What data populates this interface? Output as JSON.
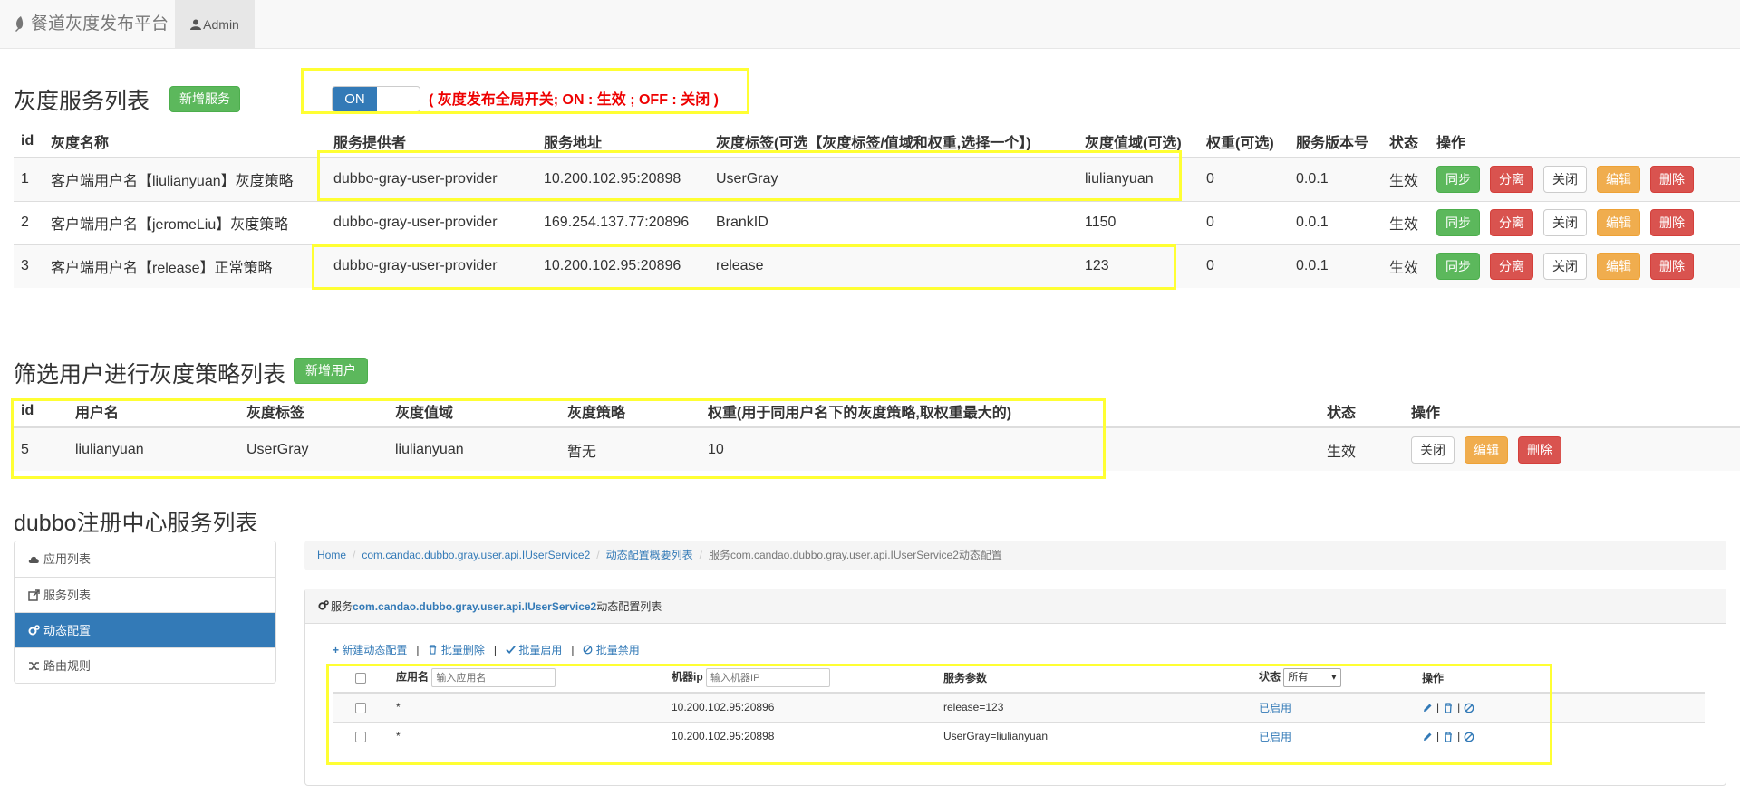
{
  "navbar": {
    "brand": "餐道灰度发布平台",
    "user": "Admin"
  },
  "gray_services": {
    "title": "灰度服务列表",
    "add_button": "新增服务",
    "toggle_on": "ON",
    "toggle_note": "( 灰度发布全局开关; ON : 生效 ; OFF : 关闭 )",
    "headers": [
      "id",
      "灰度名称",
      "服务提供者",
      "服务地址",
      "灰度标签(可选【灰度标签/值域和权重,选择一个】)",
      "灰度值域(可选)",
      "权重(可选)",
      "服务版本号",
      "状态",
      "操作"
    ],
    "rows": [
      {
        "id": "1",
        "name": "客户端用户名【liulianyuan】灰度策略",
        "provider": "dubbo-gray-user-provider",
        "address": "10.200.102.95:20898",
        "tag": "UserGray",
        "range": "liulianyuan",
        "weight": "0",
        "version": "0.0.1",
        "status": "生效"
      },
      {
        "id": "2",
        "name": "客户端用户名【jeromeLiu】灰度策略",
        "provider": "dubbo-gray-user-provider",
        "address": "169.254.137.77:20896",
        "tag": "BrankID",
        "range": "1150",
        "weight": "0",
        "version": "0.0.1",
        "status": "生效"
      },
      {
        "id": "3",
        "name": "客户端用户名【release】正常策略",
        "provider": "dubbo-gray-user-provider",
        "address": "10.200.102.95:20896",
        "tag": "release",
        "range": "123",
        "weight": "0",
        "version": "0.0.1",
        "status": "生效"
      }
    ],
    "actions": {
      "sync": "同步",
      "split": "分离",
      "close": "关闭",
      "edit": "编辑",
      "delete": "删除"
    }
  },
  "user_strategies": {
    "title": "筛选用户进行灰度策略列表",
    "add_button": "新增用户",
    "headers": [
      "id",
      "用户名",
      "灰度标签",
      "灰度值域",
      "灰度策略",
      "权重(用于同用户名下的灰度策略,取权重最大的)",
      "状态",
      "操作"
    ],
    "rows": [
      {
        "id": "5",
        "username": "liulianyuan",
        "tag": "UserGray",
        "range": "liulianyuan",
        "strategy": "暂无",
        "weight": "10",
        "status": "生效"
      }
    ],
    "actions": {
      "close": "关闭",
      "edit": "编辑",
      "delete": "删除"
    }
  },
  "registry": {
    "title": "dubbo注册中心服务列表",
    "sidebar": [
      {
        "label": "应用列表",
        "icon": "cloud-icon"
      },
      {
        "label": "服务列表",
        "icon": "share-icon"
      },
      {
        "label": "动态配置",
        "icon": "cogs-icon",
        "active": true
      },
      {
        "label": "路由规则",
        "icon": "random-icon"
      }
    ],
    "breadcrumb": [
      "Home",
      "com.candao.dubbo.gray.user.api.IUserService2",
      "动态配置概要列表",
      "服务com.candao.dubbo.gray.user.api.IUserService2动态配置"
    ],
    "panel": {
      "title_prefix": "服务",
      "title_service": "com.candao.dubbo.gray.user.api.IUserService2",
      "title_suffix": "动态配置列表",
      "toolbar": [
        "新建动态配置",
        "批量删除",
        "批量启用",
        "批量禁用"
      ],
      "headers": {
        "app": "应用名",
        "app_placeholder": "输入应用名",
        "ip": "机器ip",
        "ip_placeholder": "输入机器IP",
        "params": "服务参数",
        "status": "状态",
        "status_value": "所有",
        "ops": "操作"
      },
      "rows": [
        {
          "app": "*",
          "ip": "10.200.102.95:20896",
          "params": "release=123",
          "status": "已启用"
        },
        {
          "app": "*",
          "ip": "10.200.102.95:20898",
          "params": "UserGray=liulianyuan",
          "status": "已启用"
        }
      ]
    }
  },
  "colors": {
    "primary": "#337ab7",
    "success": "#5cb85c",
    "danger": "#d9534f",
    "warning": "#f0ad4e",
    "highlight": "#ffff33",
    "note_red": "#ee0000"
  }
}
